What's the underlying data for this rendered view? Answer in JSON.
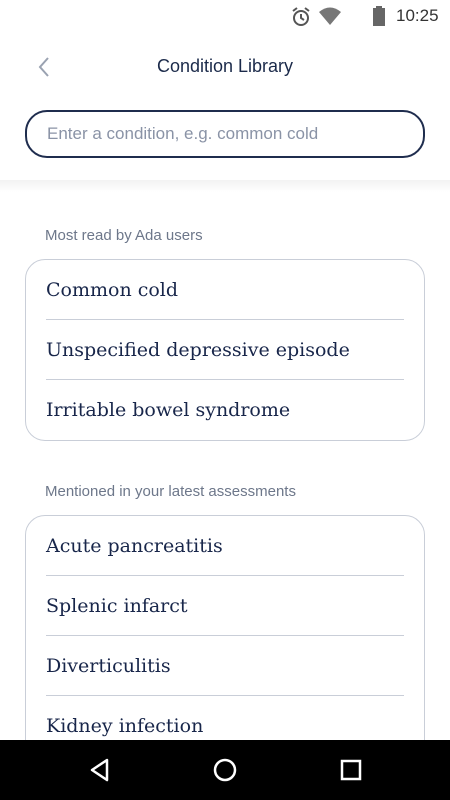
{
  "status_bar": {
    "time": "10:25",
    "icons": [
      "alarm-icon",
      "wifi-icon",
      "battery-icon"
    ]
  },
  "header": {
    "title": "Condition Library",
    "back_icon": "chevron-left-icon"
  },
  "search": {
    "placeholder": "Enter a condition, e.g. common cold",
    "value": ""
  },
  "sections": [
    {
      "label": "Most read by Ada users",
      "items": [
        "Common cold",
        "Unspecified depressive episode",
        "Irritable bowel syndrome"
      ]
    },
    {
      "label": "Mentioned in your latest assessments",
      "items": [
        "Acute pancreatitis",
        "Splenic infarct",
        "Diverticulitis",
        "Kidney infection"
      ]
    }
  ],
  "nav_bar": {
    "icons": [
      "nav-back-icon",
      "nav-home-icon",
      "nav-recent-apps-icon"
    ]
  },
  "colors": {
    "primary_text": "#1b2a4a",
    "secondary_text": "#6d778a",
    "border": "#c9ced8",
    "search_border": "#1f2d4e"
  }
}
